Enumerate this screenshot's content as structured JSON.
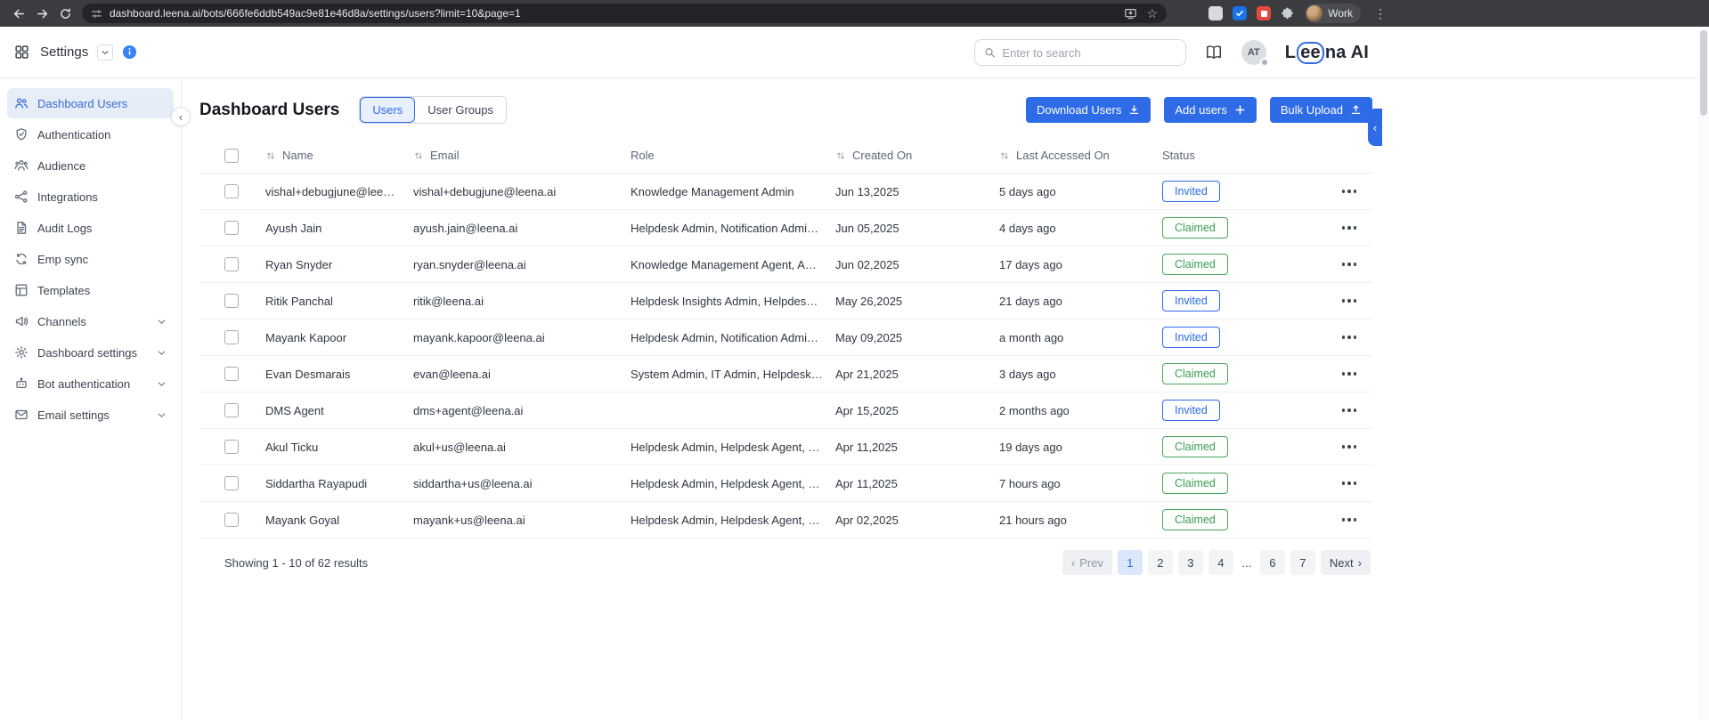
{
  "colors": {
    "accent": "#2E6BE6",
    "success": "#3C9E54"
  },
  "browser": {
    "url": "dashboard.leena.ai/bots/666fe6ddb549ac9e81e46d8a/settings/users?limit=10&page=1",
    "profile_label": "Work"
  },
  "header": {
    "menu_label": "Settings",
    "search_placeholder": "Enter to search",
    "avatar_initials": "AT",
    "logo_parts": [
      "L",
      "ee",
      "na AI"
    ]
  },
  "sidebar": {
    "items": [
      {
        "label": "Dashboard Users",
        "icon": "users",
        "active": true,
        "expandable": false
      },
      {
        "label": "Authentication",
        "icon": "shield",
        "active": false,
        "expandable": false
      },
      {
        "label": "Audience",
        "icon": "audience",
        "active": false,
        "expandable": false
      },
      {
        "label": "Integrations",
        "icon": "integrations",
        "active": false,
        "expandable": false
      },
      {
        "label": "Audit Logs",
        "icon": "document",
        "active": false,
        "expandable": false
      },
      {
        "label": "Emp sync",
        "icon": "sync",
        "active": false,
        "expandable": false
      },
      {
        "label": "Templates",
        "icon": "template",
        "active": false,
        "expandable": false
      },
      {
        "label": "Channels",
        "icon": "channels",
        "active": false,
        "expandable": true
      },
      {
        "label": "Dashboard settings",
        "icon": "gear",
        "active": false,
        "expandable": true
      },
      {
        "label": "Bot authentication",
        "icon": "bot",
        "active": false,
        "expandable": true
      },
      {
        "label": "Email settings",
        "icon": "mail",
        "active": false,
        "expandable": true
      }
    ]
  },
  "main": {
    "title": "Dashboard Users",
    "tabs": [
      {
        "label": "Users",
        "active": true
      },
      {
        "label": "User Groups",
        "active": false
      }
    ],
    "actions": [
      {
        "label": "Download Users",
        "icon": "download"
      },
      {
        "label": "Add users",
        "icon": "plus"
      },
      {
        "label": "Bulk Upload",
        "icon": "upload"
      }
    ],
    "table": {
      "columns": [
        {
          "label": "Name",
          "sortable": true
        },
        {
          "label": "Email",
          "sortable": true
        },
        {
          "label": "Role",
          "sortable": false
        },
        {
          "label": "Created On",
          "sortable": true
        },
        {
          "label": "Last Accessed On",
          "sortable": true
        },
        {
          "label": "Status",
          "sortable": false
        }
      ],
      "rows": [
        {
          "name": "vishal+debugjune@leena.ai",
          "email": "vishal+debugjune@leena.ai",
          "role": "Knowledge Management Admin",
          "created_on": "Jun 13,2025",
          "last_accessed": "5 days ago",
          "status": "Invited"
        },
        {
          "name": "Ayush Jain",
          "email": "ayush.jain@leena.ai",
          "role": "Helpdesk Admin, Notification Admin, Kn…",
          "created_on": "Jun 05,2025",
          "last_accessed": "4 days ago",
          "status": "Claimed"
        },
        {
          "name": "Ryan Snyder",
          "email": "ryan.snyder@leena.ai",
          "role": "Knowledge Management Agent, Analyti…",
          "created_on": "Jun 02,2025",
          "last_accessed": "17 days ago",
          "status": "Claimed"
        },
        {
          "name": "Ritik Panchal",
          "email": "ritik@leena.ai",
          "role": "Helpdesk Insights Admin, Helpdesk Insi…",
          "created_on": "May 26,2025",
          "last_accessed": "21 days ago",
          "status": "Invited"
        },
        {
          "name": "Mayank Kapoor",
          "email": "mayank.kapoor@leena.ai",
          "role": "Helpdesk Admin, Notification Admin, Kn…",
          "created_on": "May 09,2025",
          "last_accessed": "a month ago",
          "status": "Invited"
        },
        {
          "name": "Evan Desmarais",
          "email": "evan@leena.ai",
          "role": "System Admin, IT Admin, Helpdesk Adm…",
          "created_on": "Apr 21,2025",
          "last_accessed": "3 days ago",
          "status": "Claimed"
        },
        {
          "name": "DMS Agent",
          "email": "dms+agent@leena.ai",
          "role": "",
          "created_on": "Apr 15,2025",
          "last_accessed": "2 months ago",
          "status": "Invited"
        },
        {
          "name": "Akul Ticku",
          "email": "akul+us@leena.ai",
          "role": "Helpdesk Admin, Helpdesk Agent, Notifi…",
          "created_on": "Apr 11,2025",
          "last_accessed": "19 days ago",
          "status": "Claimed"
        },
        {
          "name": "Siddartha Rayapudi",
          "email": "siddartha+us@leena.ai",
          "role": "Helpdesk Admin, Helpdesk Agent, Notifi…",
          "created_on": "Apr 11,2025",
          "last_accessed": "7 hours ago",
          "status": "Claimed"
        },
        {
          "name": "Mayank Goyal",
          "email": "mayank+us@leena.ai",
          "role": "Helpdesk Admin, Helpdesk Agent, Notifi…",
          "created_on": "Apr 02,2025",
          "last_accessed": "21 hours ago",
          "status": "Claimed"
        }
      ]
    },
    "footer": {
      "summary": "Showing 1 - 10 of 62 results",
      "pagination": {
        "prev_label": "Prev",
        "pages": [
          "1",
          "2",
          "3",
          "4",
          "...",
          "6",
          "7"
        ],
        "active_page": "1",
        "next_label": "Next"
      }
    }
  }
}
